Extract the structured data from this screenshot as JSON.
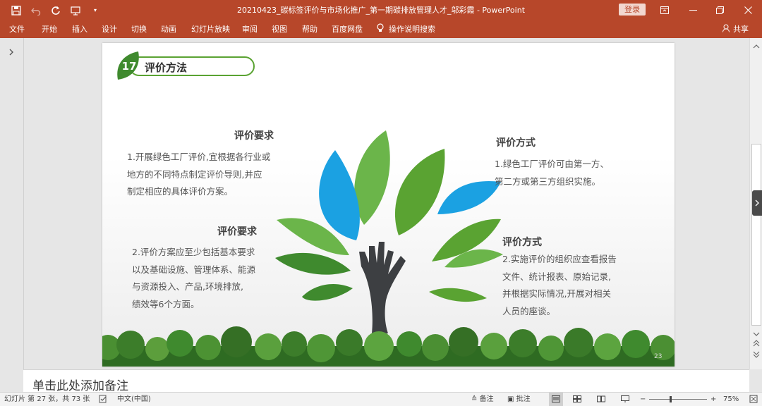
{
  "titlebar": {
    "document_title": "20210423_碳标签评价与市场化推广_第一期碳排放管理人才_邬彩霞 - PowerPoint",
    "login_label": "登录",
    "icons": [
      "save-icon",
      "undo-icon",
      "redo-icon",
      "present-from-start-icon",
      "customize-qat-icon",
      "ribbon-display-icon",
      "minimize-icon",
      "restore-icon",
      "close-icon"
    ]
  },
  "menu": {
    "items": [
      "文件",
      "开始",
      "插入",
      "设计",
      "切换",
      "动画",
      "幻灯片放映",
      "审阅",
      "视图",
      "帮助",
      "百度网盘"
    ],
    "tell_me": "操作说明搜索",
    "share": "共享"
  },
  "slide": {
    "badge_number": "17",
    "section_title": "评价方法",
    "block1": {
      "heading": "评价要求",
      "lines": [
        "1.开展绿色工厂评价,宜根据各行业或",
        "地方的不同特点制定评价导则,并应",
        "制定相应的具体评价方案。"
      ]
    },
    "block2": {
      "heading": "评价要求",
      "lines": [
        "2.评价方案应至少包括基本要求",
        "以及基础设施、管理体系、能源",
        "与资源投入、产品,环境排放,",
        "绩效等6个方面。"
      ]
    },
    "block3": {
      "heading": "评价方式",
      "lines": [
        "1.绿色工厂评价可由第一方、",
        "第二方或第三方组织实施。"
      ]
    },
    "block4": {
      "heading": "评价方式",
      "lines": [
        "2.实施评价的组织应查看报告",
        "文件、统计报表、原始记录,",
        "并根据实际情况,开展对相关",
        "人员的座谈。"
      ]
    },
    "page_number": "23",
    "colors": {
      "green": "#5aa332",
      "dark_green": "#3f8a2e",
      "leaf_green": "#6bb54a",
      "leaf_blue": "#1ba1e2",
      "trunk": "#3d3f42"
    }
  },
  "notes_placeholder": "单击此处添加备注",
  "status": {
    "slide_info": "幻灯片 第 27 张，共 73 张",
    "language": "中文(中国)",
    "notes": "备注",
    "comments": "批注",
    "zoom_minus": "−",
    "zoom_plus": "+",
    "zoom": "75%"
  }
}
